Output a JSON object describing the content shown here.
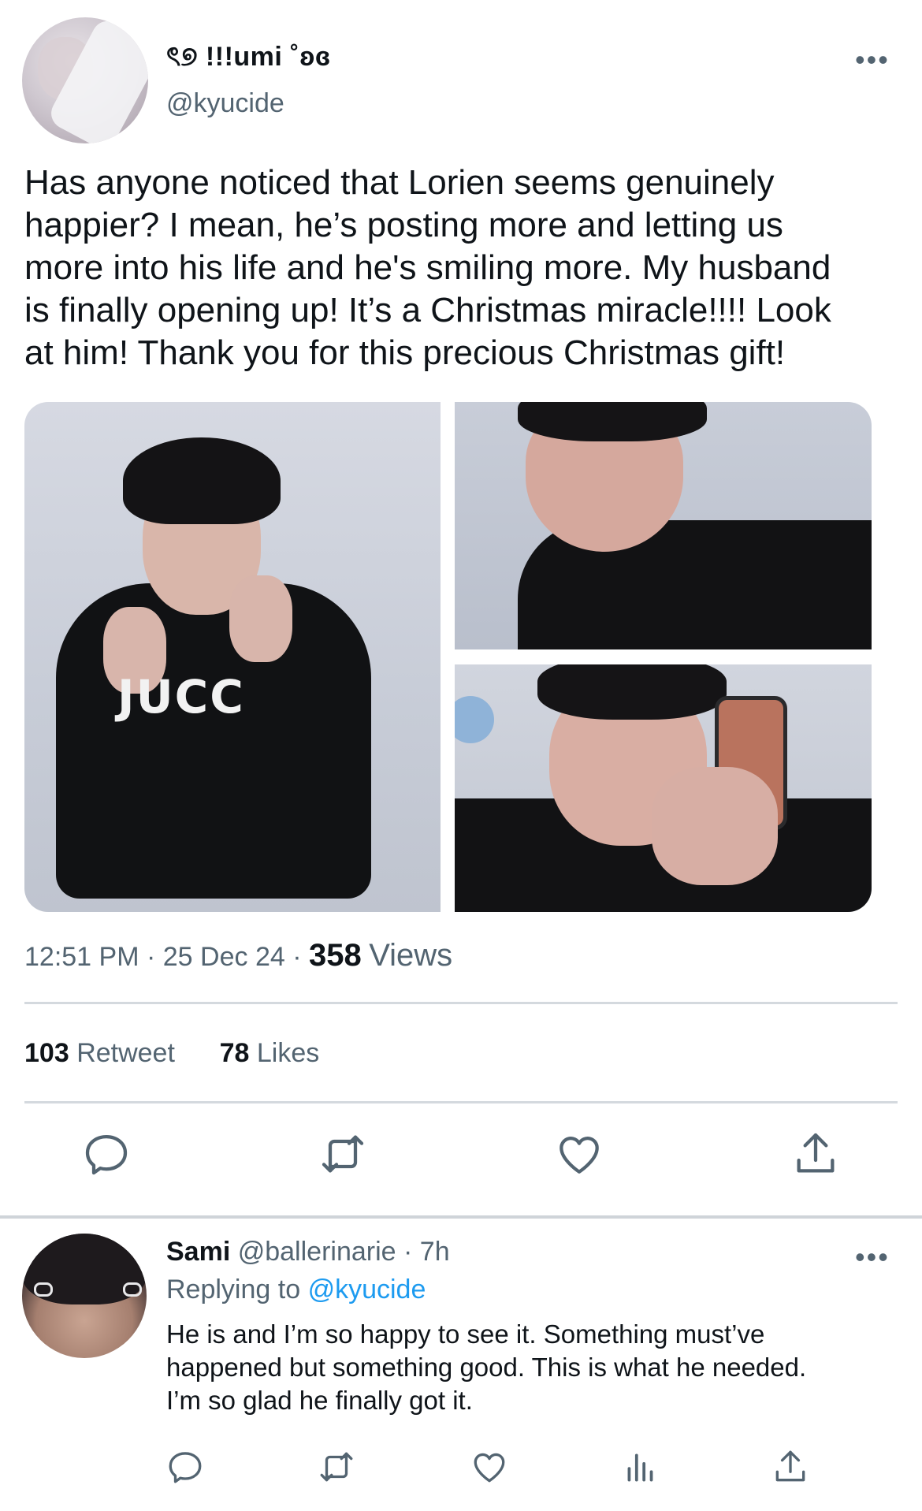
{
  "tweet": {
    "display_name": "ৎ୭ !!!umi ˚ʚɞ",
    "handle": "@kyucide",
    "more": "•••",
    "text": "Has anyone noticed that Lorien seems genuinely\nhappier? I mean, he’s posting more and letting us\nmore into his life and he's smiling more. My husband\nis finally opening up! It’s a Christmas miracle!!!! Look\nat him! Thank you for this precious Christmas gift!",
    "photo_text": "JUCC",
    "time": "12:51 PM",
    "date": "25 Dec 24",
    "separator": "·",
    "views_count": "358",
    "views_label": "Views",
    "retweet_count": "103",
    "retweet_label": "Retweet",
    "likes_count": "78",
    "likes_label": "Likes"
  },
  "actions": {
    "icons": [
      "reply-icon",
      "retweet-icon",
      "like-icon",
      "share-icon"
    ]
  },
  "reply": {
    "display_name": "Sami",
    "handle": "@ballerinarie",
    "separator": "·",
    "age": "7h",
    "more": "•••",
    "replying_prefix": "Replying to",
    "replying_handle": "@kyucide",
    "text": "He is and I’m so happy to see it. Something must’ve\nhappened but something good. This is what he needed.\nI’m so glad he finally got it.",
    "action_icons": [
      "reply-icon",
      "retweet-icon",
      "like-icon",
      "views-icon",
      "share-icon"
    ]
  },
  "colors": {
    "text": "#0f1419",
    "secondary": "#536471",
    "link": "#1d9bf0",
    "divider": "#d4d9de"
  }
}
